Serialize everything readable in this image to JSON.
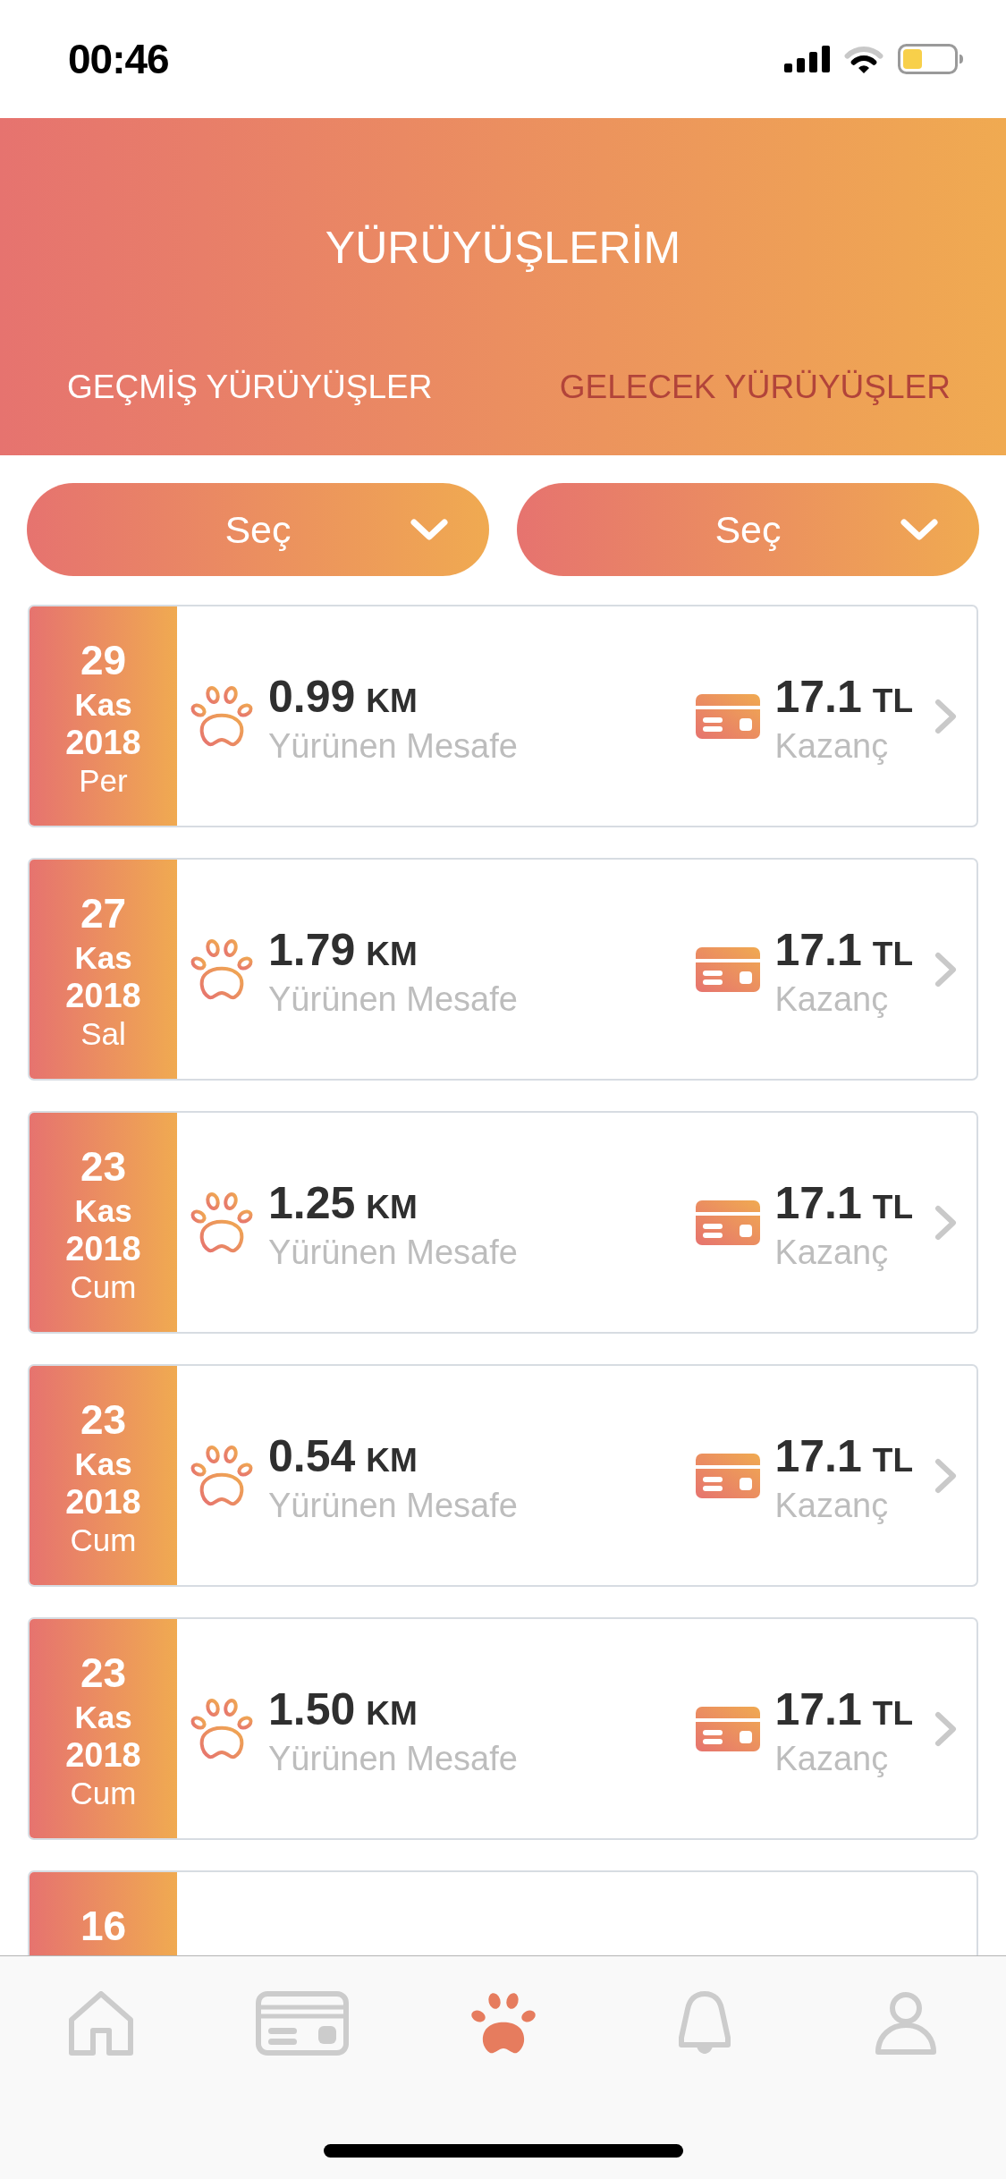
{
  "status_bar": {
    "time": "00:46"
  },
  "header": {
    "title": "YÜRÜYÜŞLERİM",
    "tabs": [
      {
        "label": "GEÇMİŞ YÜRÜYÜŞLER",
        "selected": true
      },
      {
        "label": "GELECEK YÜRÜYÜŞLER",
        "selected": false
      }
    ]
  },
  "filters": [
    {
      "label": "Seç"
    },
    {
      "label": "Seç"
    }
  ],
  "walks": [
    {
      "day": "29",
      "month": "Kas",
      "year": "2018",
      "weekday": "Per",
      "distance": "0.99",
      "distance_unit": "KM",
      "distance_label": "Yürünen Mesafe",
      "earning": "17.1",
      "earning_unit": "TL",
      "earning_label": "Kazanç"
    },
    {
      "day": "27",
      "month": "Kas",
      "year": "2018",
      "weekday": "Sal",
      "distance": "1.79",
      "distance_unit": "KM",
      "distance_label": "Yürünen Mesafe",
      "earning": "17.1",
      "earning_unit": "TL",
      "earning_label": "Kazanç"
    },
    {
      "day": "23",
      "month": "Kas",
      "year": "2018",
      "weekday": "Cum",
      "distance": "1.25",
      "distance_unit": "KM",
      "distance_label": "Yürünen Mesafe",
      "earning": "17.1",
      "earning_unit": "TL",
      "earning_label": "Kazanç"
    },
    {
      "day": "23",
      "month": "Kas",
      "year": "2018",
      "weekday": "Cum",
      "distance": "0.54",
      "distance_unit": "KM",
      "distance_label": "Yürünen Mesafe",
      "earning": "17.1",
      "earning_unit": "TL",
      "earning_label": "Kazanç"
    },
    {
      "day": "23",
      "month": "Kas",
      "year": "2018",
      "weekday": "Cum",
      "distance": "1.50",
      "distance_unit": "KM",
      "distance_label": "Yürünen Mesafe",
      "earning": "17.1",
      "earning_unit": "TL",
      "earning_label": "Kazanç"
    },
    {
      "day": "16"
    }
  ],
  "tab_bar": {
    "items": [
      {
        "kind": "home",
        "selected": false
      },
      {
        "kind": "card",
        "selected": false
      },
      {
        "kind": "paw",
        "selected": true
      },
      {
        "kind": "bell",
        "selected": false
      },
      {
        "kind": "person",
        "selected": false
      }
    ]
  }
}
